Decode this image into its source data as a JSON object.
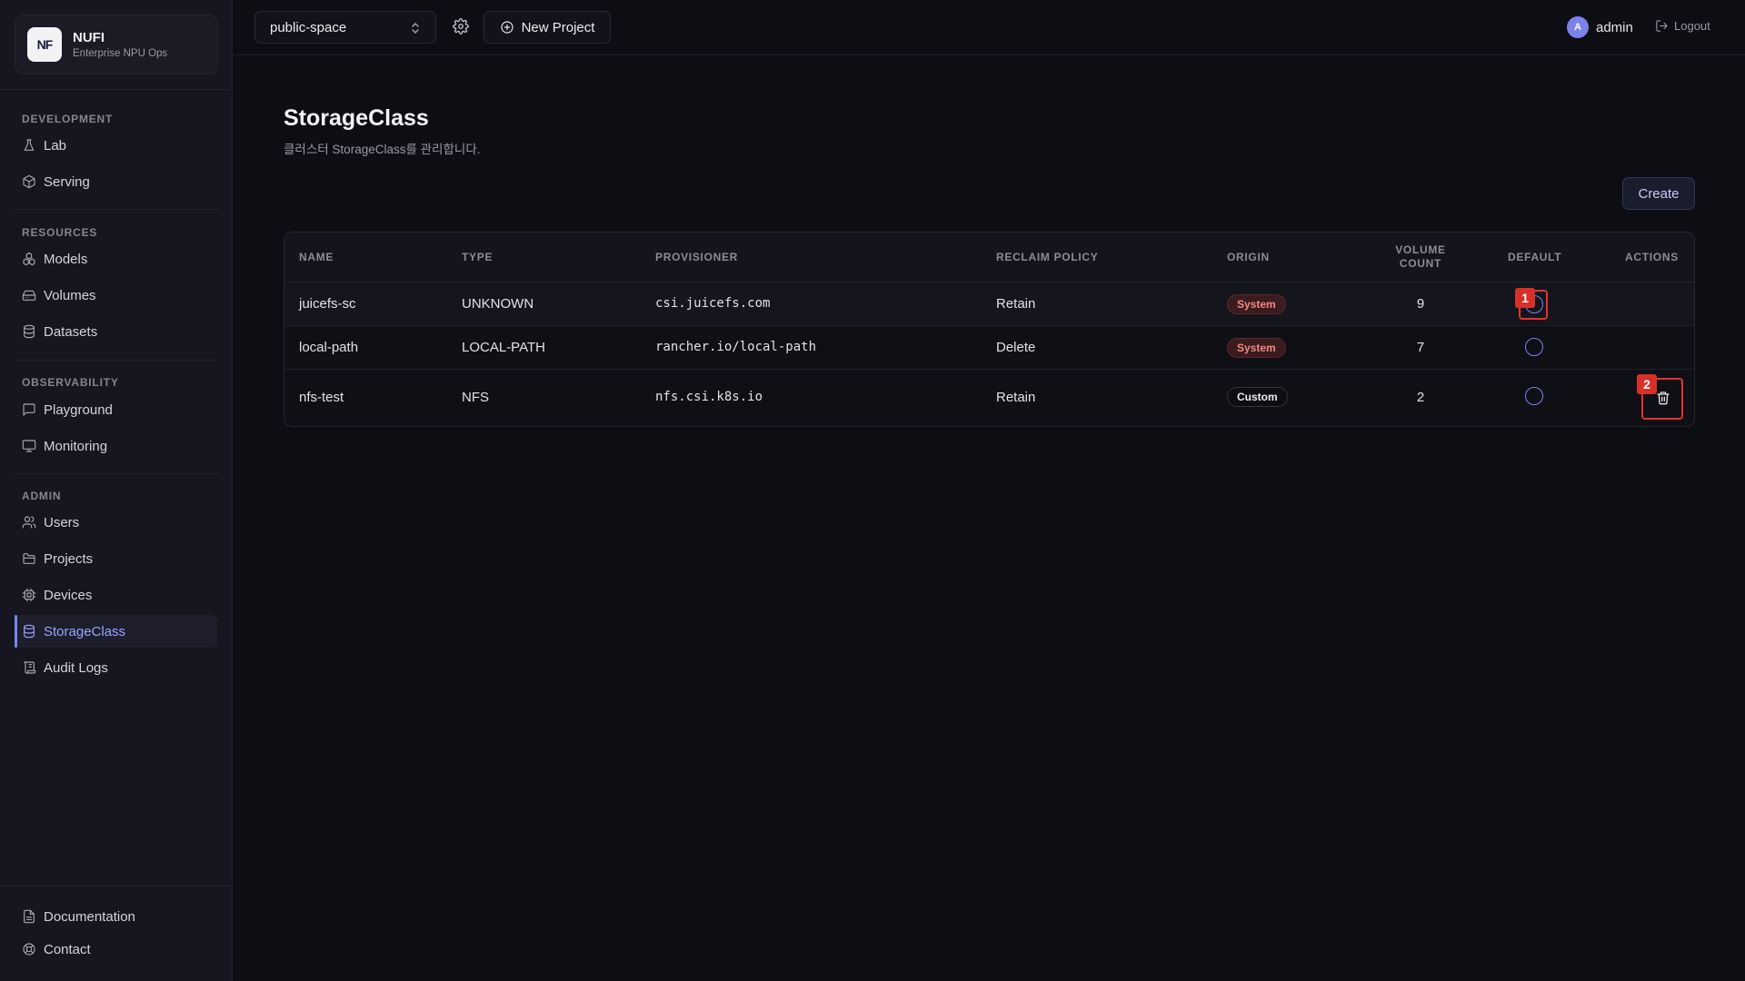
{
  "brand": {
    "logo_text": "NF",
    "name": "NUFI",
    "subtitle": "Enterprise NPU Ops"
  },
  "sidebar": {
    "sections": [
      {
        "label": "DEVELOPMENT",
        "items": [
          {
            "label": "Lab",
            "icon": "flask-icon"
          },
          {
            "label": "Serving",
            "icon": "cube-icon"
          }
        ]
      },
      {
        "label": "RESOURCES",
        "items": [
          {
            "label": "Models",
            "icon": "boxes-icon"
          },
          {
            "label": "Volumes",
            "icon": "hard-drive-icon"
          },
          {
            "label": "Datasets",
            "icon": "database-icon"
          }
        ]
      },
      {
        "label": "OBSERVABILITY",
        "items": [
          {
            "label": "Playground",
            "icon": "chat-icon"
          },
          {
            "label": "Monitoring",
            "icon": "monitor-icon"
          }
        ]
      },
      {
        "label": "ADMIN",
        "items": [
          {
            "label": "Users",
            "icon": "users-icon"
          },
          {
            "label": "Projects",
            "icon": "folder-icon"
          },
          {
            "label": "Devices",
            "icon": "cpu-icon"
          },
          {
            "label": "StorageClass",
            "icon": "database-icon",
            "active": true
          },
          {
            "label": "Audit Logs",
            "icon": "scroll-icon"
          }
        ]
      }
    ],
    "footer": [
      {
        "label": "Documentation",
        "icon": "document-icon"
      },
      {
        "label": "Contact",
        "icon": "lifebuoy-icon"
      }
    ]
  },
  "topbar": {
    "project": "public-space",
    "new_project_label": "New Project",
    "user": {
      "initial": "A",
      "name": "admin"
    },
    "logout_label": "Logout"
  },
  "page": {
    "title": "StorageClass",
    "subtitle": "클러스터 StorageClass를 관리합니다.",
    "create_label": "Create"
  },
  "table": {
    "headers": {
      "name": "NAME",
      "type": "TYPE",
      "provisioner": "PROVISIONER",
      "reclaim": "RECLAIM POLICY",
      "origin": "ORIGIN",
      "volume_line1": "VOLUME",
      "volume_line2": "COUNT",
      "default": "DEFAULT",
      "actions": "ACTIONS"
    },
    "rows": [
      {
        "name": "juicefs-sc",
        "type": "UNKNOWN",
        "provisioner": "csi.juicefs.com",
        "reclaim": "Retain",
        "origin": "System",
        "volume_count": "9"
      },
      {
        "name": "local-path",
        "type": "LOCAL-PATH",
        "provisioner": "rancher.io/local-path",
        "reclaim": "Delete",
        "origin": "System",
        "volume_count": "7"
      },
      {
        "name": "nfs-test",
        "type": "NFS",
        "provisioner": "nfs.csi.k8s.io",
        "reclaim": "Retain",
        "origin": "Custom",
        "volume_count": "2"
      }
    ]
  },
  "markers": [
    {
      "label": "1"
    },
    {
      "label": "2"
    }
  ],
  "colors": {
    "accent": "#7c84f0",
    "marker": "#e5332a",
    "system_badge": "#f08a80"
  }
}
